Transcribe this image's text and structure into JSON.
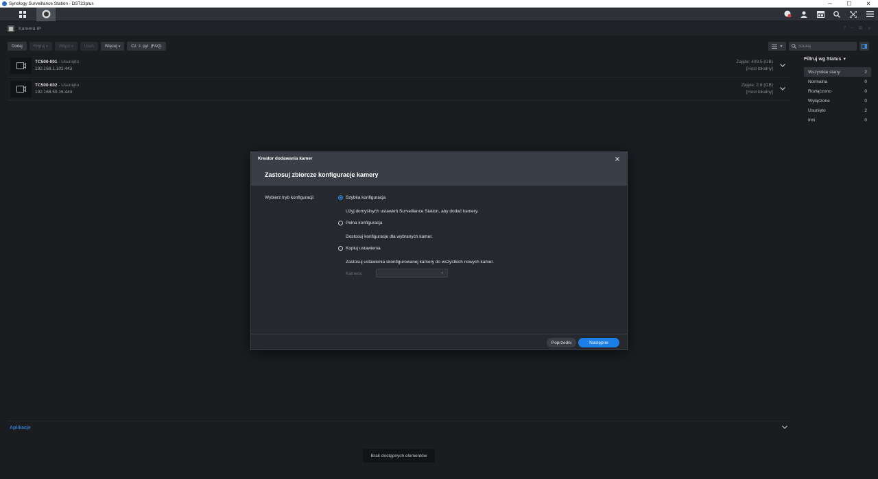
{
  "os": {
    "title": "Synology Surveillance Station - DS723plus",
    "minimize": "─",
    "maximize": "☐",
    "close": "✕"
  },
  "window": {
    "title": "Kamera IP"
  },
  "toolbar": {
    "add": "Dodaj",
    "edit": "Edytuj",
    "enable": "Włącz",
    "delete": "Usuń",
    "more": "Więcej",
    "faq": "Cz. z. pyt. (FAQ)"
  },
  "search": {
    "placeholder": "Szukaj"
  },
  "cameras": [
    {
      "name": "TC500-001",
      "status": " - Usunięto",
      "address": "192.168.1.102:443",
      "usage": "Zajęte: 409.5 (GB)",
      "host": "[Host lokalny]"
    },
    {
      "name": "TC500-002",
      "status": " - Usunięto",
      "address": "192.168.50.15:443",
      "usage": "Zajęte: 2.8 (GB)",
      "host": "[Host lokalny]"
    }
  ],
  "filter": {
    "title": "Filtruj wg Status",
    "items": [
      {
        "label": "Wszystkie stany",
        "count": "2"
      },
      {
        "label": "Normalna",
        "count": "0"
      },
      {
        "label": "Rozłączono",
        "count": "0"
      },
      {
        "label": "Wyłączone",
        "count": "0"
      },
      {
        "label": "Usunięto",
        "count": "2"
      },
      {
        "label": "Inni",
        "count": "0"
      }
    ]
  },
  "apps": {
    "title": "Aplikacje",
    "empty": "Brak dostępnych elementów"
  },
  "dialog": {
    "caption": "Kreator dodawania kamer",
    "heading": "Zastosuj zbiorcze konfiguracje kamery",
    "mode_label": "Wybierz tryb konfiguracji:",
    "options": [
      {
        "label": "Szybka konfiguracja",
        "desc": "Użyj domyślnych ustawień Surveillance Station, aby dodać kamery."
      },
      {
        "label": "Pełna konfiguracja",
        "desc": "Dostosuj konfiguracje dla wybranych kamer."
      },
      {
        "label": "Kopiuj ustawienia",
        "desc": "Zastosuj ustawienia skonfigurowanej kamery do wszystkich nowych kamer."
      }
    ],
    "selected_option": "Szybka konfiguracja",
    "camera_label": "Kamera:",
    "camera_value": "",
    "prev": "Poprzedni",
    "next": "Następne"
  },
  "colors": {
    "accent": "#1b7ee6",
    "background": "#1f2126",
    "link": "#3b8ee8"
  }
}
